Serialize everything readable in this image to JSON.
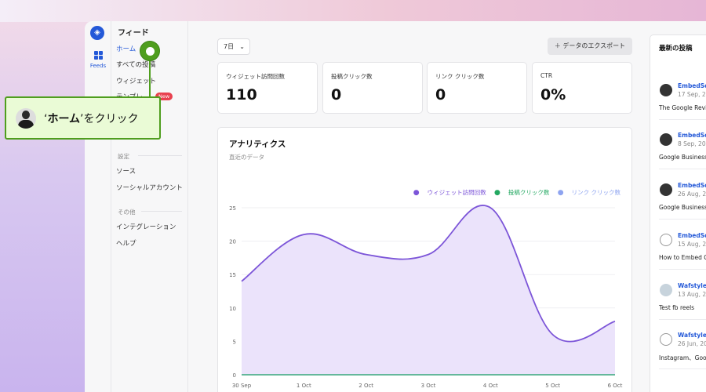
{
  "rail": {
    "feeds_label": "Feeds"
  },
  "sidebar": {
    "title": "フィード",
    "items": [
      {
        "label": "ホーム",
        "active": true
      },
      {
        "label": "すべての投稿"
      },
      {
        "label": "ウィジェット"
      },
      {
        "label": "テンプレ",
        "badge": "New"
      }
    ],
    "sections": [
      {
        "title": "設定",
        "items": [
          "ソース",
          "ソーシャルアカウント"
        ]
      },
      {
        "title": "その他",
        "items": [
          "インテグレーション",
          "ヘルプ"
        ]
      }
    ]
  },
  "toolbar": {
    "period": "7日",
    "export_label": "データのエクスポート"
  },
  "stats": [
    {
      "label": "ウィジェット訪問回数",
      "value": "110"
    },
    {
      "label": "投稿クリック数",
      "value": "0"
    },
    {
      "label": "リンク クリック数",
      "value": "0"
    },
    {
      "label": "CTR",
      "value": "0%"
    }
  ],
  "analytics": {
    "title": "アナリティクス",
    "subtitle": "直近のデータ"
  },
  "chart_data": {
    "type": "area",
    "categories": [
      "30 Sep",
      "1 Oct",
      "2 Oct",
      "3 Oct",
      "4 Oct",
      "5 Oct",
      "6 Oct"
    ],
    "ylim": [
      0,
      25
    ],
    "yticks": [
      0,
      5,
      10,
      15,
      20,
      25
    ],
    "grid": true,
    "legend": "top-right",
    "series": [
      {
        "name": "ウィジェット訪問回数",
        "color": "#7c55d8",
        "values": [
          14,
          21,
          18,
          18,
          25,
          6,
          8
        ]
      },
      {
        "name": "投稿クリック数",
        "color": "#23a861",
        "values": [
          0,
          0,
          0,
          0,
          0,
          0,
          0
        ]
      },
      {
        "name": "リンク クリック数",
        "color": "#8ea4f0",
        "values": [
          0,
          0,
          0,
          0,
          0,
          0,
          0
        ]
      }
    ]
  },
  "recent": {
    "title": "最新の投稿",
    "posts": [
      {
        "name": "EmbedSoc",
        "date": "17 Sep, 20",
        "text": "The Google Revie"
      },
      {
        "name": "EmbedSoc",
        "date": "8 Sep, 202",
        "text": "Google Business"
      },
      {
        "name": "EmbedSoc",
        "date": "26 Aug, 20",
        "text": "Google Business"
      },
      {
        "name": "EmbedSoc",
        "date": "15 Aug, 20",
        "text": "How to Embed G"
      },
      {
        "name": "Wafstyle F",
        "date": "13 Aug, 20",
        "text": "Test fb reels"
      },
      {
        "name": "Wafstyle-",
        "date": "26 Jun, 20",
        "text": "Instagram、Goo"
      }
    ]
  },
  "callout": {
    "quote_open": "‘",
    "target": "ホーム",
    "quote_close": "’",
    "action": "をクリック"
  }
}
